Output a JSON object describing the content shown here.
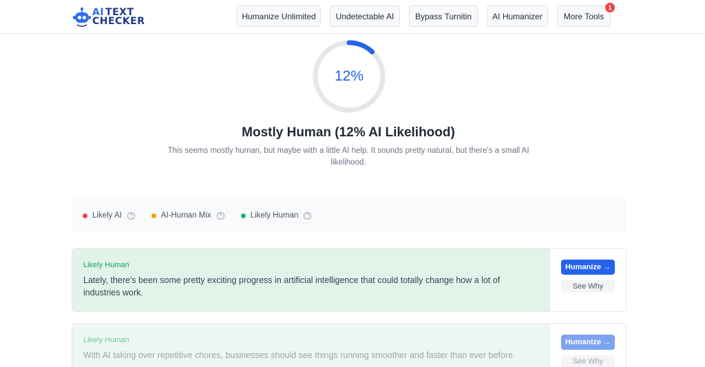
{
  "logo": {
    "line1_ai": "AI",
    "line1_rest": "TEXT",
    "line2": "CHECKER"
  },
  "nav": {
    "items": [
      {
        "label": "Humanize Unlimited"
      },
      {
        "label": "Undetectable AI"
      },
      {
        "label": "Bypass Turnitin"
      },
      {
        "label": "AI Humanizer"
      },
      {
        "label": "More Tools"
      }
    ],
    "more_badge": "1"
  },
  "result": {
    "percent_label": "12%",
    "percent_value": 12,
    "title": "Mostly Human (12% AI Likelihood)",
    "description": "This seems mostly human, but maybe with a little AI help. It sounds pretty natural, but there's a small AI likelihood."
  },
  "legend": {
    "items": [
      {
        "label": "Likely AI",
        "color": "#ef4444"
      },
      {
        "label": "AI-Human Mix",
        "color": "#f59e0b"
      },
      {
        "label": "Likely Human",
        "color": "#10b981"
      }
    ],
    "help_glyph": "?"
  },
  "segments": [
    {
      "label": "Likely Human",
      "text": "Lately, there's been some pretty exciting progress in artificial intelligence that could totally change how a lot of industries work.",
      "humanize": "Humanize →",
      "why": "See Why"
    },
    {
      "label": "Likely Human",
      "text": "With AI taking over repetitive chores, businesses should see things running smoother and faster than ever before.",
      "humanize": "Humanize →",
      "why": "See Why"
    }
  ],
  "colors": {
    "accent": "#2563eb",
    "human_bg": "#e2f3ea",
    "human_label": "#10a36b"
  }
}
